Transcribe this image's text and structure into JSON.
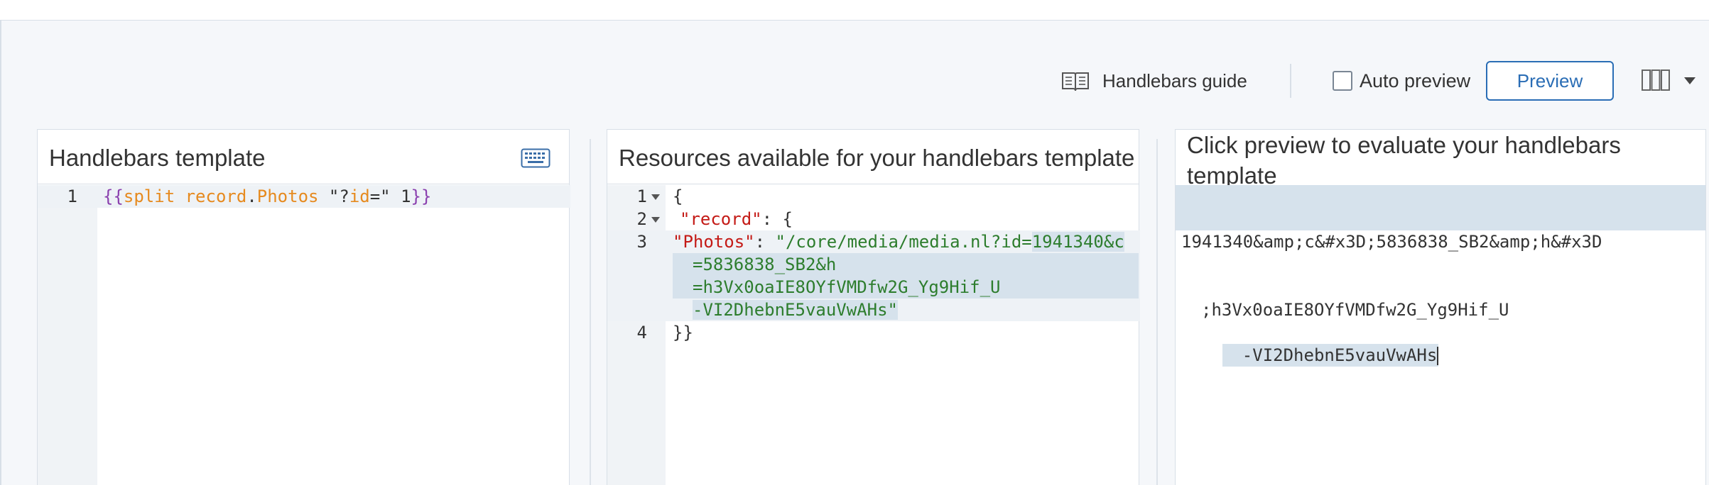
{
  "toolbar": {
    "guide_label": "Handlebars guide",
    "guide_icon": "book-open-icon",
    "auto_preview_label": "Auto preview",
    "auto_preview_checked": false,
    "preview_label": "Preview",
    "layout_icon": "columns-layout-icon"
  },
  "template_panel": {
    "title": "Handlebars template",
    "keyboard_icon": "keyboard-icon",
    "line_numbers": [
      "1"
    ],
    "code": {
      "open": "{{",
      "helper": "split",
      "obj": "record",
      "dot": ".",
      "prop": "Photos",
      "arg_str_open": " \"?",
      "arg_var": "id",
      "arg_str_close": "=\"",
      "arg_num": " 1",
      "close": "}}"
    }
  },
  "resources_panel": {
    "title": "Resources available for your handlebars template",
    "line_numbers": [
      "1",
      "2",
      "3",
      "4"
    ],
    "lines": {
      "l1": "{",
      "l2_key": "\"record\"",
      "l2_rest": ": {",
      "l3_key": "\"Photos\"",
      "l3_colon": ": ",
      "l3_val_a": "\"/core/media/media.nl?id=",
      "l3_val_b": "1941340&c",
      "l3_val_c": "=5836838_SB2&h",
      "l3_val_d": "=h3Vx0oaIE8OYfVMDfw2G_Yg9Hif_U",
      "l3_val_e": "-VI2DhebnE5vauVwAHs\"",
      "l4": "}}"
    }
  },
  "preview_panel": {
    "title_line1": "Click preview to evaluate your handlebars",
    "title_line2": "template",
    "output": {
      "line1": "1941340&amp;c&#x3D;5836838_SB2&amp;h&#x3D",
      "line2": ";h3Vx0oaIE8OYfVMDfw2G_Yg9Hif_U",
      "line3": "-VI2DhebnE5vauVwAHs"
    }
  }
}
